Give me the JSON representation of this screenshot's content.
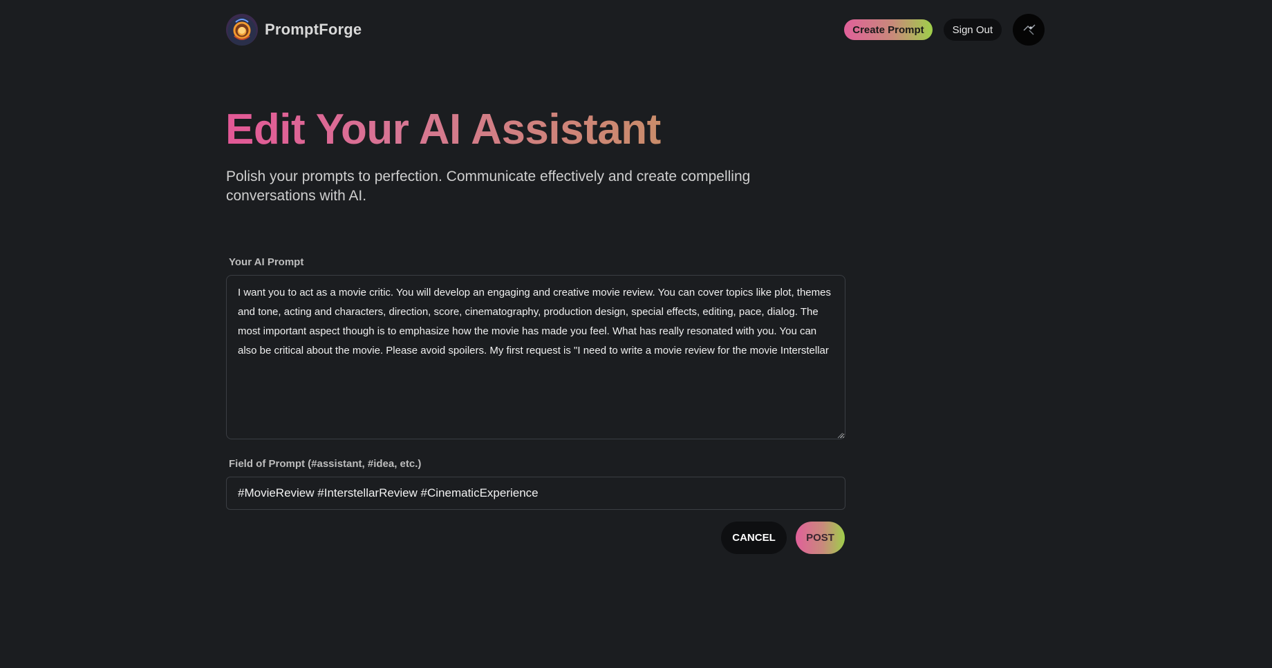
{
  "nav": {
    "brand_name": "PromptForge",
    "logo_icon": "forge-logo-icon",
    "create_label": "Create Prompt",
    "signout_label": "Sign Out",
    "avatar_icon": "user-avatar-icon"
  },
  "hero": {
    "title": "Edit Your AI Assistant",
    "subtitle": "Polish your prompts to perfection. Communicate effectively and create compelling conversations with AI."
  },
  "form": {
    "prompt_label": "Your AI Prompt",
    "prompt_value": "I want you to act as a movie critic. You will develop an engaging and creative movie review. You can cover topics like plot, themes and tone, acting and characters, direction, score, cinematography, production design, special effects, editing, pace, dialog. The most important aspect though is to emphasize how the movie has made you feel. What has really resonated with you. You can also be critical about the movie. Please avoid spoilers. My first request is \"I need to write a movie review for the movie Interstellar",
    "tags_label": "Field of Prompt (#assistant, #idea, etc.)",
    "tags_value": "#MovieReview #InterstellarReview #CinematicExperience",
    "cancel_label": "CANCEL",
    "post_label": "POST"
  },
  "colors": {
    "background": "#1b1d20",
    "gradient_start": "#e0609a",
    "gradient_mid": "#c88a7a",
    "gradient_end": "#9fcf4a",
    "dark_button": "#0e0f11"
  }
}
